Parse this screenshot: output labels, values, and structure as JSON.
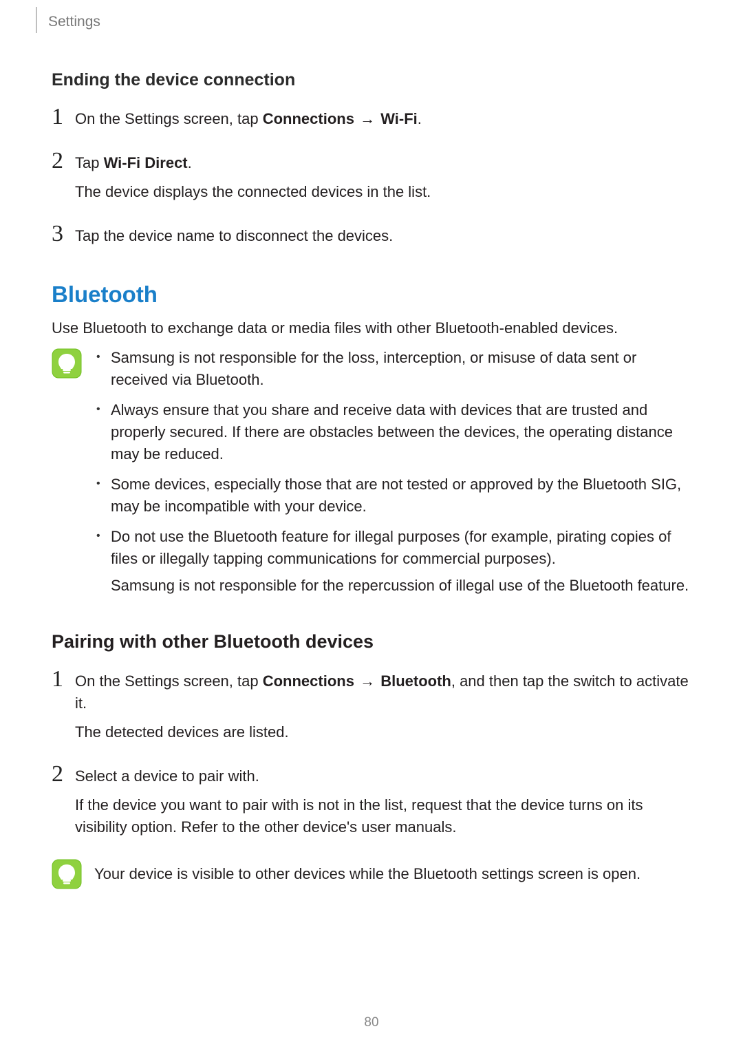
{
  "header": {
    "label": "Settings"
  },
  "sectionA": {
    "heading": "Ending the device connection",
    "steps": [
      {
        "num": "1",
        "prefix": "On the Settings screen, tap ",
        "bold1": "Connections",
        "arrow": " → ",
        "bold2": "Wi-Fi",
        "suffix": "."
      },
      {
        "num": "2",
        "prefix": "Tap ",
        "bold1": "Wi-Fi Direct",
        "suffix": ".",
        "extra": "The device displays the connected devices in the list."
      },
      {
        "num": "3",
        "text": "Tap the device name to disconnect the devices."
      }
    ]
  },
  "sectionB": {
    "title": "Bluetooth",
    "intro": "Use Bluetooth to exchange data or media files with other Bluetooth-enabled devices.",
    "notes": [
      "Samsung is not responsible for the loss, interception, or misuse of data sent or received via Bluetooth.",
      "Always ensure that you share and receive data with devices that are trusted and properly secured. If there are obstacles between the devices, the operating distance may be reduced.",
      "Some devices, especially those that are not tested or approved by the Bluetooth SIG, may be incompatible with your device."
    ],
    "note4": {
      "line1": "Do not use the Bluetooth feature for illegal purposes (for example, pirating copies of files or illegally tapping communications for commercial purposes).",
      "line2": "Samsung is not responsible for the repercussion of illegal use of the Bluetooth feature."
    }
  },
  "sectionC": {
    "heading": "Pairing with other Bluetooth devices",
    "steps": [
      {
        "num": "1",
        "prefix": "On the Settings screen, tap ",
        "bold1": "Connections",
        "arrow": " → ",
        "bold2": "Bluetooth",
        "suffix": ", and then tap the switch to activate it.",
        "extra": "The detected devices are listed."
      },
      {
        "num": "2",
        "text": "Select a device to pair with.",
        "extra": "If the device you want to pair with is not in the list, request that the device turns on its visibility option. Refer to the other device's user manuals."
      }
    ],
    "tip": "Your device is visible to other devices while the Bluetooth settings screen is open."
  },
  "pageNumber": "80"
}
